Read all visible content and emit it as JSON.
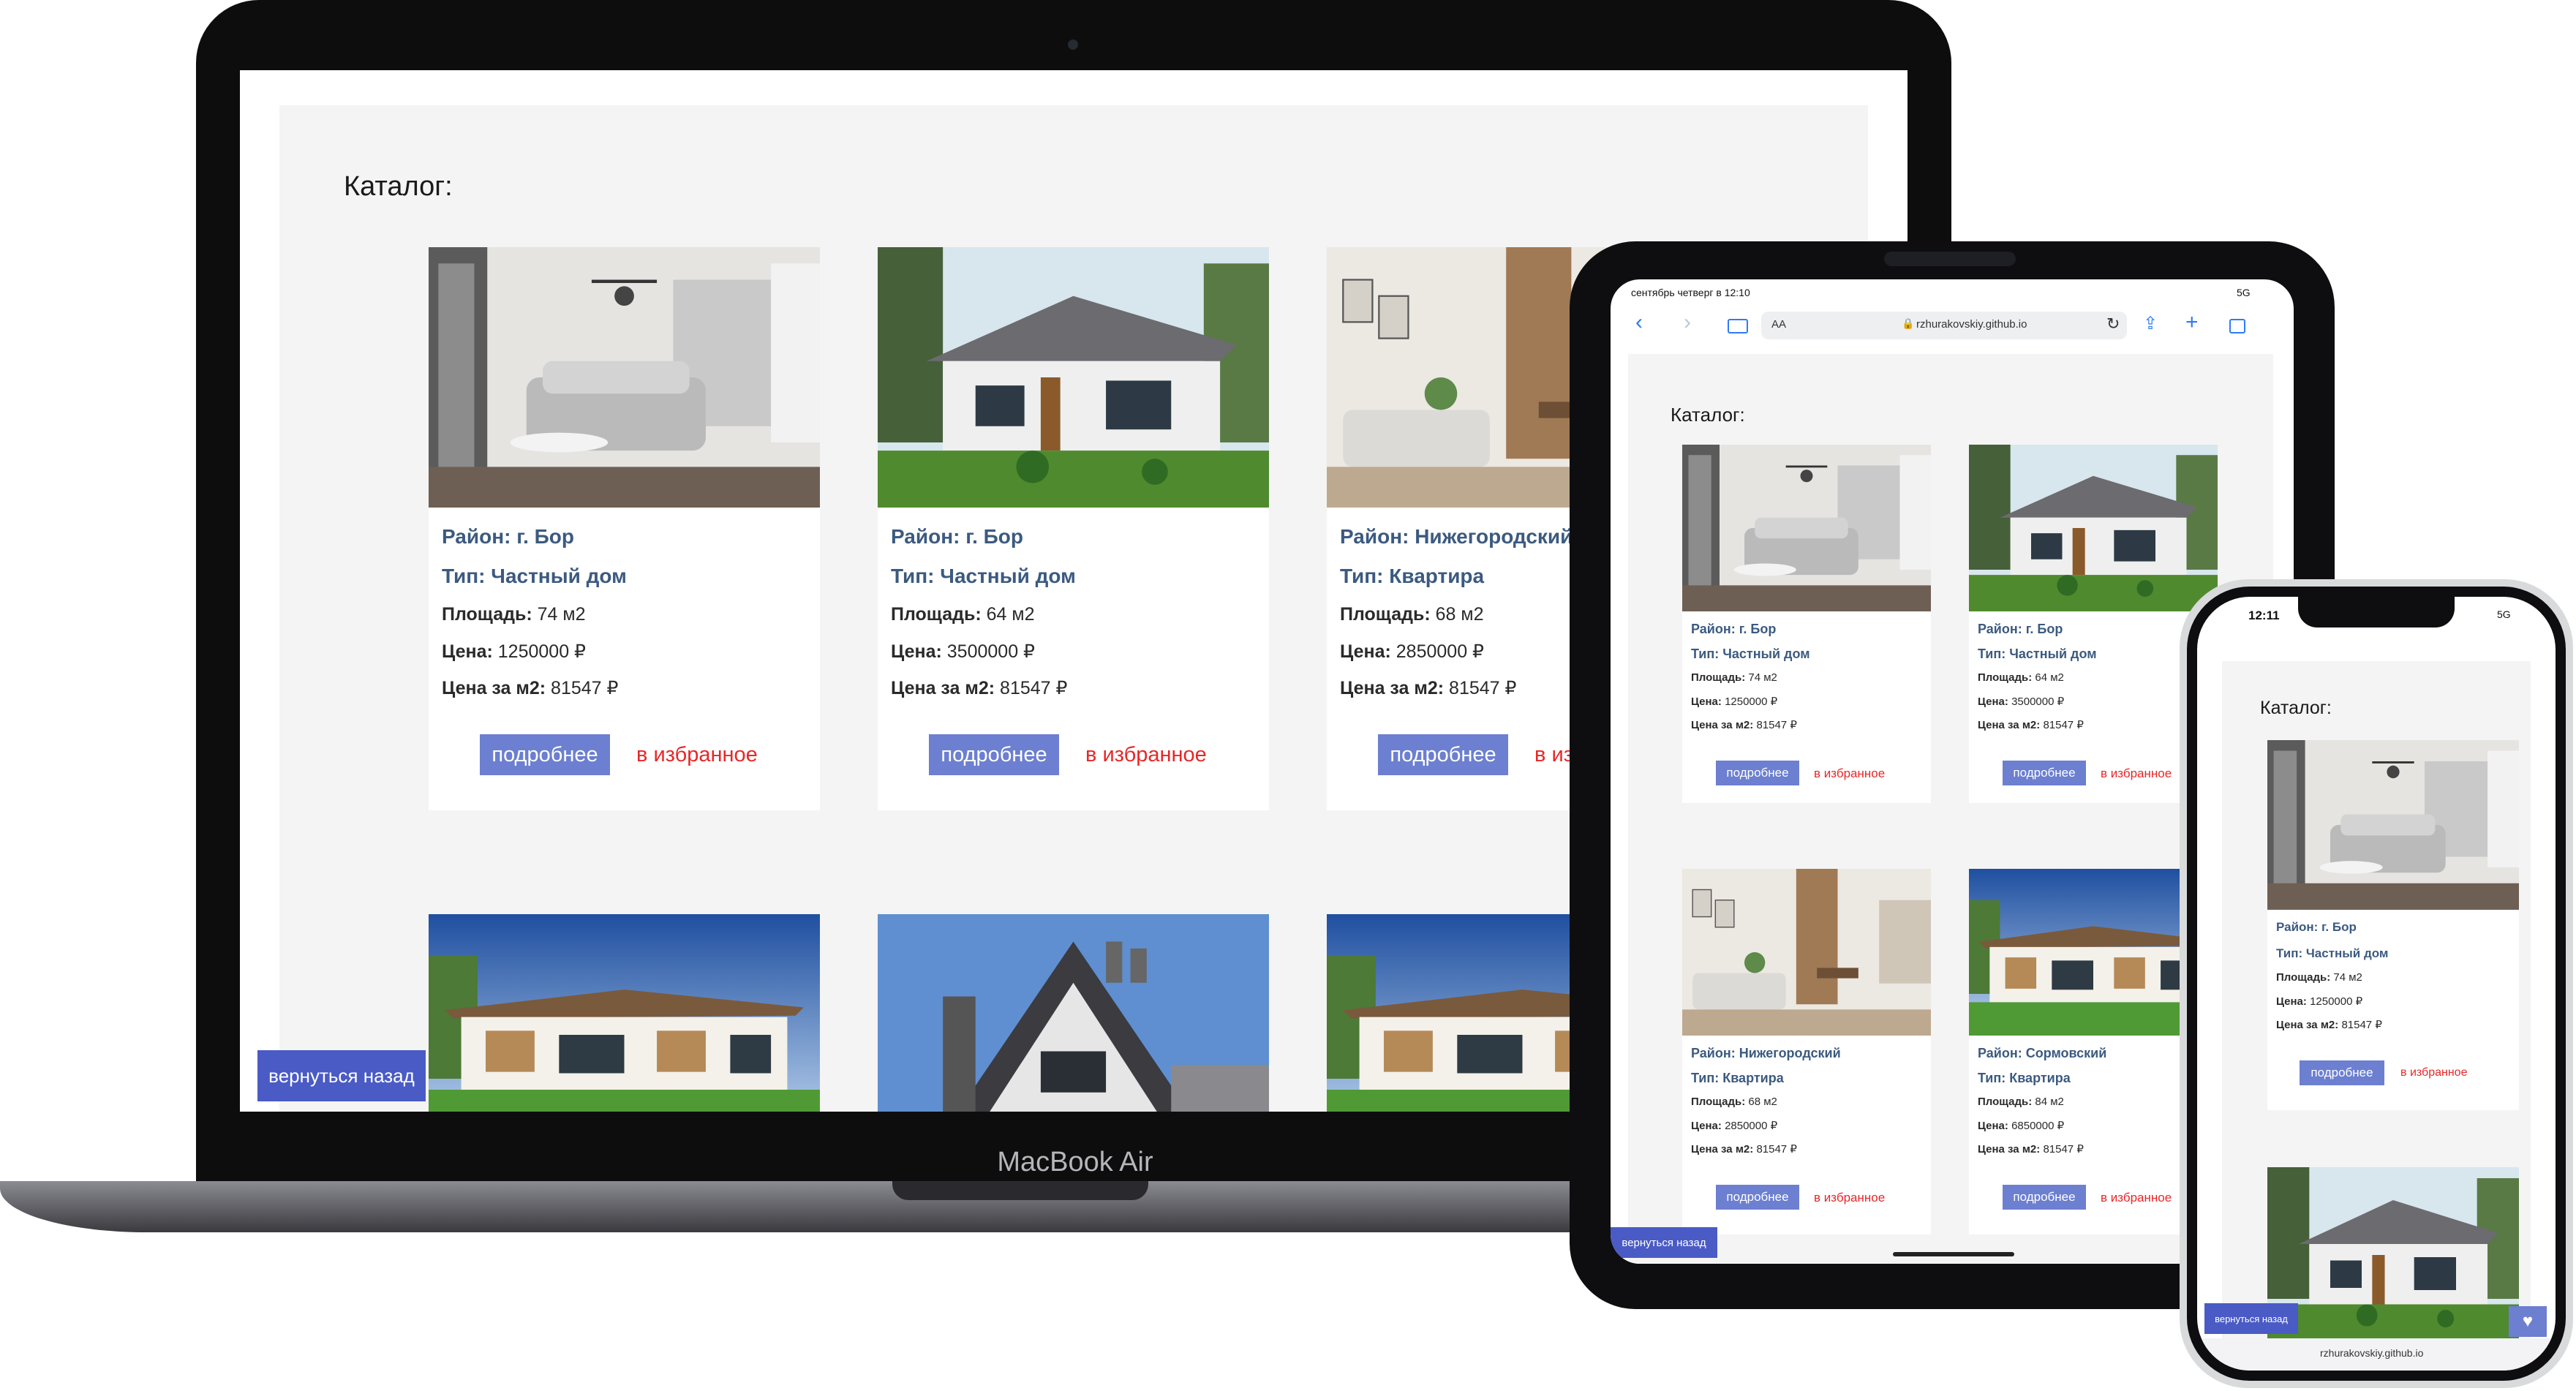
{
  "catalog_title": "Каталог:",
  "laptop_label": "MacBook Air",
  "listings": [
    {
      "district": "Район: г. Бор",
      "type": "Тип: Частный дом",
      "area_label": "Площадь:",
      "area": "74 м2",
      "price_label": "Цена:",
      "price": "1250000 ₽",
      "ppm_label": "Цена за м2:",
      "ppm": "81547 ₽",
      "image": "interior-living-room"
    },
    {
      "district": "Район: г. Бор",
      "type": "Тип: Частный дом",
      "area_label": "Площадь:",
      "area": "64 м2",
      "price_label": "Цена:",
      "price": "3500000 ₽",
      "ppm_label": "Цена за м2:",
      "ppm": "81547 ₽",
      "image": "single-story-house"
    },
    {
      "district": "Район: Нижегородский",
      "type": "Тип: Квартира",
      "area_label": "Площадь:",
      "area": "68 м2",
      "price_label": "Цена:",
      "price": "2850000 ₽",
      "ppm_label": "Цена за м2:",
      "ppm": "81547 ₽",
      "image": "interior-dining-room"
    },
    {
      "district": "Район: Сормовский",
      "type": "Тип: Квартира",
      "area_label": "Площадь:",
      "area": "84 м2",
      "price_label": "Цена:",
      "price": "6850000 ₽",
      "ppm_label": "Цена за м2:",
      "ppm": "81547 ₽",
      "image": "modern-two-story-house"
    }
  ],
  "buttons": {
    "more": "подробнее",
    "favorite": "в избранное",
    "back": "вернуться назад"
  },
  "tablet": {
    "status_time": "сентябрь четверг в 12:10",
    "status_network": "5G",
    "address_aa": "AA",
    "address_url": "rzhurakovskiy.github.io"
  },
  "phone": {
    "status_time": "12:11",
    "status_network": "5G",
    "address_url": "rzhurakovskiy.github.io"
  },
  "colors": {
    "primary_button": "#6c7fd0",
    "back_button": "#4a5bc5",
    "favorite_link": "#e82727",
    "title_text": "#3c5a80",
    "page_background": "#f4f4f4"
  }
}
